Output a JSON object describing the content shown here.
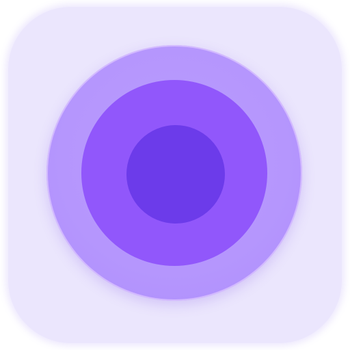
{
  "app_icon": {
    "icon": "concentric-circles-icon",
    "colors": {
      "tile_background": "#ebe6fd",
      "outer_ring": "#b596fd",
      "middle_ring": "#9157fb",
      "inner_circle": "#6c3bea"
    }
  }
}
